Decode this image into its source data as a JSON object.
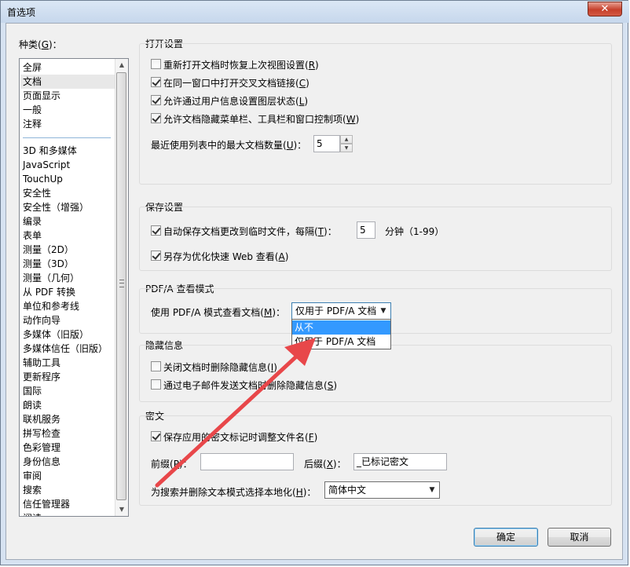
{
  "window": {
    "title": "首选项",
    "close_glyph": "✕"
  },
  "categories": {
    "label_prefix": "种类(",
    "label_key": "G",
    "label_suffix": ")：",
    "group1": [
      "全屏",
      "文档",
      "页面显示",
      "一般",
      "注释"
    ],
    "group2": [
      "3D 和多媒体",
      "JavaScript",
      "TouchUp",
      "安全性",
      "安全性（增强）",
      "编录",
      "表单",
      "测量（2D）",
      "测量（3D）",
      "测量（几何）",
      "从 PDF 转换",
      "单位和参考线",
      "动作向导",
      "多媒体（旧版）",
      "多媒体信任（旧版）",
      "辅助工具",
      "更新程序",
      "国际",
      "朗读",
      "联机服务",
      "拼写检查",
      "色彩管理",
      "身份信息",
      "审阅",
      "搜索",
      "信任管理器",
      "阅读"
    ],
    "selected": "文档"
  },
  "open_settings": {
    "title": "打开设置",
    "options": [
      {
        "text": "重新打开文档时恢复上次视图设置(",
        "key": "R",
        "end": ")",
        "checked": false
      },
      {
        "text": "在同一窗口中打开交叉文档链接(",
        "key": "C",
        "end": ")",
        "checked": true
      },
      {
        "text": "允许通过用户信息设置图层状态(",
        "key": "L",
        "end": ")",
        "checked": true
      },
      {
        "text": "允许文档隐藏菜单栏、工具栏和窗口控制项(",
        "key": "W",
        "end": ")",
        "checked": true
      }
    ],
    "recent_label_a": "最近使用列表中的最大文档数量(",
    "recent_key": "U",
    "recent_label_b": ")：",
    "recent_value": "5"
  },
  "save_settings": {
    "title": "保存设置",
    "autosave_a": "自动保存文档更改到临时文件，每隔(",
    "autosave_key": "T",
    "autosave_b": ")：",
    "autosave_value": "5",
    "minutes": "分钟（1-99）",
    "optimize_a": "另存为优化快速 Web 查看(",
    "optimize_key": "A",
    "optimize_b": ")"
  },
  "pdfa": {
    "title": "PDF/A 查看模式",
    "label_a": "使用 PDF/A 模式查看文档(",
    "label_key": "M",
    "label_b": ")：",
    "selected": "仅用于 PDF/A 文档",
    "options": [
      "从不",
      "仅用于 PDF/A 文档"
    ]
  },
  "hidden_info": {
    "title": "隐藏信息",
    "opt1_a": "关闭文档时删除隐藏信息(",
    "opt1_key": "I",
    "opt1_b": ")",
    "opt2_a": "通过电子邮件发送文档时删除隐藏信息(",
    "opt2_key": "S",
    "opt2_b": ")"
  },
  "redaction": {
    "title": "密文",
    "save_a": "保存应用的密文标记时调整文件名(",
    "save_key": "F",
    "save_b": ")",
    "prefix_a": "前缀(",
    "prefix_key": "P",
    "prefix_b": ")：",
    "prefix_value": "",
    "suffix_a": "后缀(",
    "suffix_key": "X",
    "suffix_b": ")：",
    "suffix_value": "_已标记密文",
    "locale_a": "为搜索并删除文本模式选择本地化(",
    "locale_key": "H",
    "locale_b": ")：",
    "locale_value": "简体中文"
  },
  "buttons": {
    "ok": "确定",
    "cancel": "取消"
  },
  "colors": {
    "arrow": "#e8474a",
    "highlight": "#3399ff"
  }
}
